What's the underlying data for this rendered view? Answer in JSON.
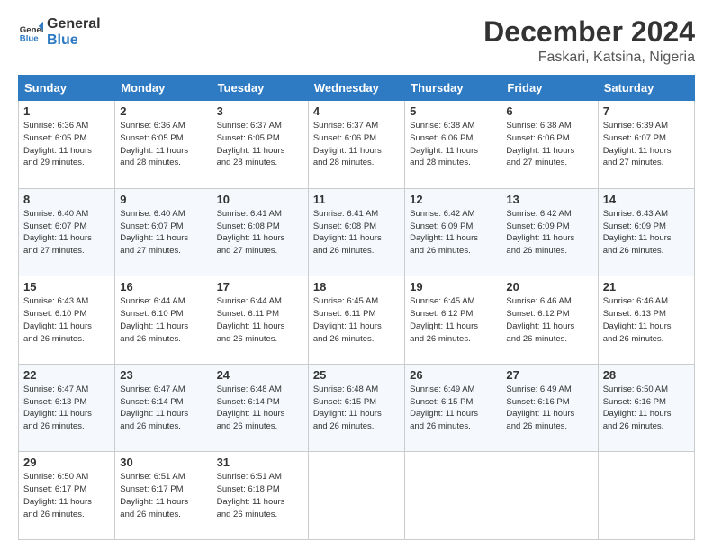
{
  "header": {
    "logo_line1": "General",
    "logo_line2": "Blue",
    "month": "December 2024",
    "location": "Faskari, Katsina, Nigeria"
  },
  "days_of_week": [
    "Sunday",
    "Monday",
    "Tuesday",
    "Wednesday",
    "Thursday",
    "Friday",
    "Saturday"
  ],
  "weeks": [
    [
      {
        "day": "1",
        "info": "Sunrise: 6:36 AM\nSunset: 6:05 PM\nDaylight: 11 hours\nand 29 minutes."
      },
      {
        "day": "2",
        "info": "Sunrise: 6:36 AM\nSunset: 6:05 PM\nDaylight: 11 hours\nand 28 minutes."
      },
      {
        "day": "3",
        "info": "Sunrise: 6:37 AM\nSunset: 6:05 PM\nDaylight: 11 hours\nand 28 minutes."
      },
      {
        "day": "4",
        "info": "Sunrise: 6:37 AM\nSunset: 6:06 PM\nDaylight: 11 hours\nand 28 minutes."
      },
      {
        "day": "5",
        "info": "Sunrise: 6:38 AM\nSunset: 6:06 PM\nDaylight: 11 hours\nand 28 minutes."
      },
      {
        "day": "6",
        "info": "Sunrise: 6:38 AM\nSunset: 6:06 PM\nDaylight: 11 hours\nand 27 minutes."
      },
      {
        "day": "7",
        "info": "Sunrise: 6:39 AM\nSunset: 6:07 PM\nDaylight: 11 hours\nand 27 minutes."
      }
    ],
    [
      {
        "day": "8",
        "info": "Sunrise: 6:40 AM\nSunset: 6:07 PM\nDaylight: 11 hours\nand 27 minutes."
      },
      {
        "day": "9",
        "info": "Sunrise: 6:40 AM\nSunset: 6:07 PM\nDaylight: 11 hours\nand 27 minutes."
      },
      {
        "day": "10",
        "info": "Sunrise: 6:41 AM\nSunset: 6:08 PM\nDaylight: 11 hours\nand 27 minutes."
      },
      {
        "day": "11",
        "info": "Sunrise: 6:41 AM\nSunset: 6:08 PM\nDaylight: 11 hours\nand 26 minutes."
      },
      {
        "day": "12",
        "info": "Sunrise: 6:42 AM\nSunset: 6:09 PM\nDaylight: 11 hours\nand 26 minutes."
      },
      {
        "day": "13",
        "info": "Sunrise: 6:42 AM\nSunset: 6:09 PM\nDaylight: 11 hours\nand 26 minutes."
      },
      {
        "day": "14",
        "info": "Sunrise: 6:43 AM\nSunset: 6:09 PM\nDaylight: 11 hours\nand 26 minutes."
      }
    ],
    [
      {
        "day": "15",
        "info": "Sunrise: 6:43 AM\nSunset: 6:10 PM\nDaylight: 11 hours\nand 26 minutes."
      },
      {
        "day": "16",
        "info": "Sunrise: 6:44 AM\nSunset: 6:10 PM\nDaylight: 11 hours\nand 26 minutes."
      },
      {
        "day": "17",
        "info": "Sunrise: 6:44 AM\nSunset: 6:11 PM\nDaylight: 11 hours\nand 26 minutes."
      },
      {
        "day": "18",
        "info": "Sunrise: 6:45 AM\nSunset: 6:11 PM\nDaylight: 11 hours\nand 26 minutes."
      },
      {
        "day": "19",
        "info": "Sunrise: 6:45 AM\nSunset: 6:12 PM\nDaylight: 11 hours\nand 26 minutes."
      },
      {
        "day": "20",
        "info": "Sunrise: 6:46 AM\nSunset: 6:12 PM\nDaylight: 11 hours\nand 26 minutes."
      },
      {
        "day": "21",
        "info": "Sunrise: 6:46 AM\nSunset: 6:13 PM\nDaylight: 11 hours\nand 26 minutes."
      }
    ],
    [
      {
        "day": "22",
        "info": "Sunrise: 6:47 AM\nSunset: 6:13 PM\nDaylight: 11 hours\nand 26 minutes."
      },
      {
        "day": "23",
        "info": "Sunrise: 6:47 AM\nSunset: 6:14 PM\nDaylight: 11 hours\nand 26 minutes."
      },
      {
        "day": "24",
        "info": "Sunrise: 6:48 AM\nSunset: 6:14 PM\nDaylight: 11 hours\nand 26 minutes."
      },
      {
        "day": "25",
        "info": "Sunrise: 6:48 AM\nSunset: 6:15 PM\nDaylight: 11 hours\nand 26 minutes."
      },
      {
        "day": "26",
        "info": "Sunrise: 6:49 AM\nSunset: 6:15 PM\nDaylight: 11 hours\nand 26 minutes."
      },
      {
        "day": "27",
        "info": "Sunrise: 6:49 AM\nSunset: 6:16 PM\nDaylight: 11 hours\nand 26 minutes."
      },
      {
        "day": "28",
        "info": "Sunrise: 6:50 AM\nSunset: 6:16 PM\nDaylight: 11 hours\nand 26 minutes."
      }
    ],
    [
      {
        "day": "29",
        "info": "Sunrise: 6:50 AM\nSunset: 6:17 PM\nDaylight: 11 hours\nand 26 minutes."
      },
      {
        "day": "30",
        "info": "Sunrise: 6:51 AM\nSunset: 6:17 PM\nDaylight: 11 hours\nand 26 minutes."
      },
      {
        "day": "31",
        "info": "Sunrise: 6:51 AM\nSunset: 6:18 PM\nDaylight: 11 hours\nand 26 minutes."
      },
      {
        "day": "",
        "info": ""
      },
      {
        "day": "",
        "info": ""
      },
      {
        "day": "",
        "info": ""
      },
      {
        "day": "",
        "info": ""
      }
    ]
  ]
}
